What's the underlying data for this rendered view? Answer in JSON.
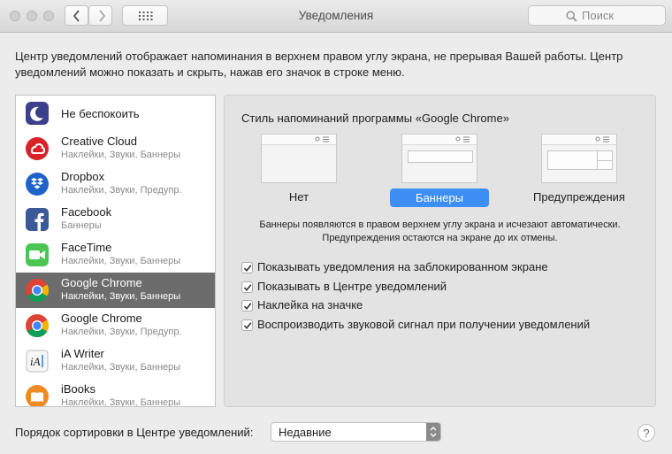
{
  "window": {
    "title": "Уведомления"
  },
  "toolbar": {
    "search_placeholder": "Поиск"
  },
  "description": "Центр уведомлений отображает напоминания в верхнем правом углу экрана, не прерывая Вашей работы. Центр уведомлений можно показать и скрыть, нажав его значок в строке меню.",
  "apps": [
    {
      "name": "Не беспокоить",
      "sub": "",
      "icon": "moon-icon"
    },
    {
      "name": "Creative Cloud",
      "sub": "Наклейки, Звуки, Баннеры",
      "icon": "creative-cloud-icon"
    },
    {
      "name": "Dropbox",
      "sub": "Наклейки, Звуки, Предупр.",
      "icon": "dropbox-icon"
    },
    {
      "name": "Facebook",
      "sub": "Баннеры",
      "icon": "facebook-icon"
    },
    {
      "name": "FaceTime",
      "sub": "Наклейки, Звуки, Баннеры",
      "icon": "facetime-icon"
    },
    {
      "name": "Google Chrome",
      "sub": "Наклейки, Звуки, Баннеры",
      "icon": "chrome-icon",
      "selected": true
    },
    {
      "name": "Google Chrome",
      "sub": "Наклейки, Звуки, Предупр.",
      "icon": "chrome-icon"
    },
    {
      "name": "iA Writer",
      "sub": "Наклейки, Звуки, Баннеры",
      "icon": "ia-writer-icon"
    },
    {
      "name": "iBooks",
      "sub": "Наклейки, Звуки, Баннеры",
      "icon": "ibooks-icon"
    }
  ],
  "panel": {
    "title": "Стиль напоминаний программы «Google Chrome»",
    "styles": [
      {
        "label": "Нет",
        "selected": false
      },
      {
        "label": "Баннеры",
        "selected": true
      },
      {
        "label": "Предупреждения",
        "selected": false
      }
    ],
    "info_line1": "Баннеры появляются в правом верхнем углу экрана и исчезают автоматически.",
    "info_line2": "Предупреждения остаются на экране до их отмены.",
    "checkboxes": [
      {
        "label": "Показывать уведомления на заблокированном экране",
        "checked": true
      },
      {
        "label": "Показывать в Центре уведомлений",
        "checked": true
      },
      {
        "label": "Наклейка на значке",
        "checked": true
      },
      {
        "label": "Воспроизводить звуковой сигнал при получении уведомлений",
        "checked": true
      }
    ]
  },
  "footer": {
    "sort_label": "Порядок сортировки в Центре уведомлений:",
    "sort_value": "Недавние",
    "help": "?"
  },
  "colors": {
    "selection": "#6c6c6c",
    "accent": "#3d8ff5"
  }
}
